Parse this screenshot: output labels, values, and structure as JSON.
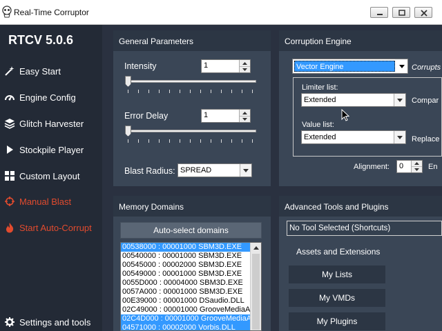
{
  "window": {
    "title": "Real-Time Corruptor",
    "minimize_icon": "minimize-icon",
    "maximize_icon": "maximize-icon",
    "close_icon": "close-icon"
  },
  "sidebar": {
    "version": "RTCV 5.0.6",
    "items": [
      {
        "label": "Easy Start",
        "icon": "wand-icon"
      },
      {
        "label": "Engine Config",
        "icon": "gauge-icon"
      },
      {
        "label": "Glitch Harvester",
        "icon": "layers-icon"
      },
      {
        "label": "Stockpile Player",
        "icon": "play-icon"
      },
      {
        "label": "Custom Layout",
        "icon": "grid-icon"
      },
      {
        "label": "Manual Blast",
        "icon": "crosshair-icon"
      },
      {
        "label": "Start Auto-Corrupt",
        "icon": "flame-icon"
      },
      {
        "label": "Settings and tools",
        "icon": "gear-icon"
      }
    ],
    "accent_color": "#e14b2e"
  },
  "general": {
    "title": "General Parameters",
    "intensity_label": "Intensity",
    "intensity_value": "1",
    "error_delay_label": "Error Delay",
    "error_delay_value": "1",
    "blast_radius_label": "Blast Radius:",
    "blast_radius_value": "SPREAD"
  },
  "engine": {
    "title": "Corruption Engine",
    "engine_value": "Vector Engine",
    "corrupts_label": "Corrupts",
    "limiter_label": "Limiter list:",
    "limiter_value": "Extended",
    "compare_label": "Compar",
    "value_label": "Value list:",
    "value_value": "Extended",
    "replace_label": "Replace",
    "alignment_label": "Alignment:",
    "alignment_value": "0",
    "en_label": "En"
  },
  "memory": {
    "title": "Memory Domains",
    "auto_select_label": "Auto-select domains",
    "domains": [
      {
        "text": "00538000 : 00001000 SBM3D.EXE",
        "selected": true
      },
      {
        "text": "00540000 : 00001000 SBM3D.EXE",
        "selected": false
      },
      {
        "text": "00545000 : 00002000 SBM3D.EXE",
        "selected": false
      },
      {
        "text": "00549000 : 00001000 SBM3D.EXE",
        "selected": false
      },
      {
        "text": "0055D000 : 00004000 SBM3D.EXE",
        "selected": false
      },
      {
        "text": "0057A000 : 00001000 SBM3D.EXE",
        "selected": false
      },
      {
        "text": "00E39000 : 00001000 DSaudio.DLL",
        "selected": false
      },
      {
        "text": "02C49000 : 00001000 GrooveMediaA",
        "selected": false
      },
      {
        "text": "02C4D000 : 00001000 GrooveMediaA",
        "selected": true
      },
      {
        "text": "04571000 : 00002000 Vorbis.DLL",
        "selected": true
      }
    ]
  },
  "tools": {
    "title": "Advanced Tools and Plugins",
    "tool_select_value": "No Tool Selected (Shortcuts)",
    "assets_label": "Assets and Extensions",
    "my_lists": "My Lists",
    "my_vmds": "My VMDs",
    "my_plugins": "My Plugins"
  }
}
